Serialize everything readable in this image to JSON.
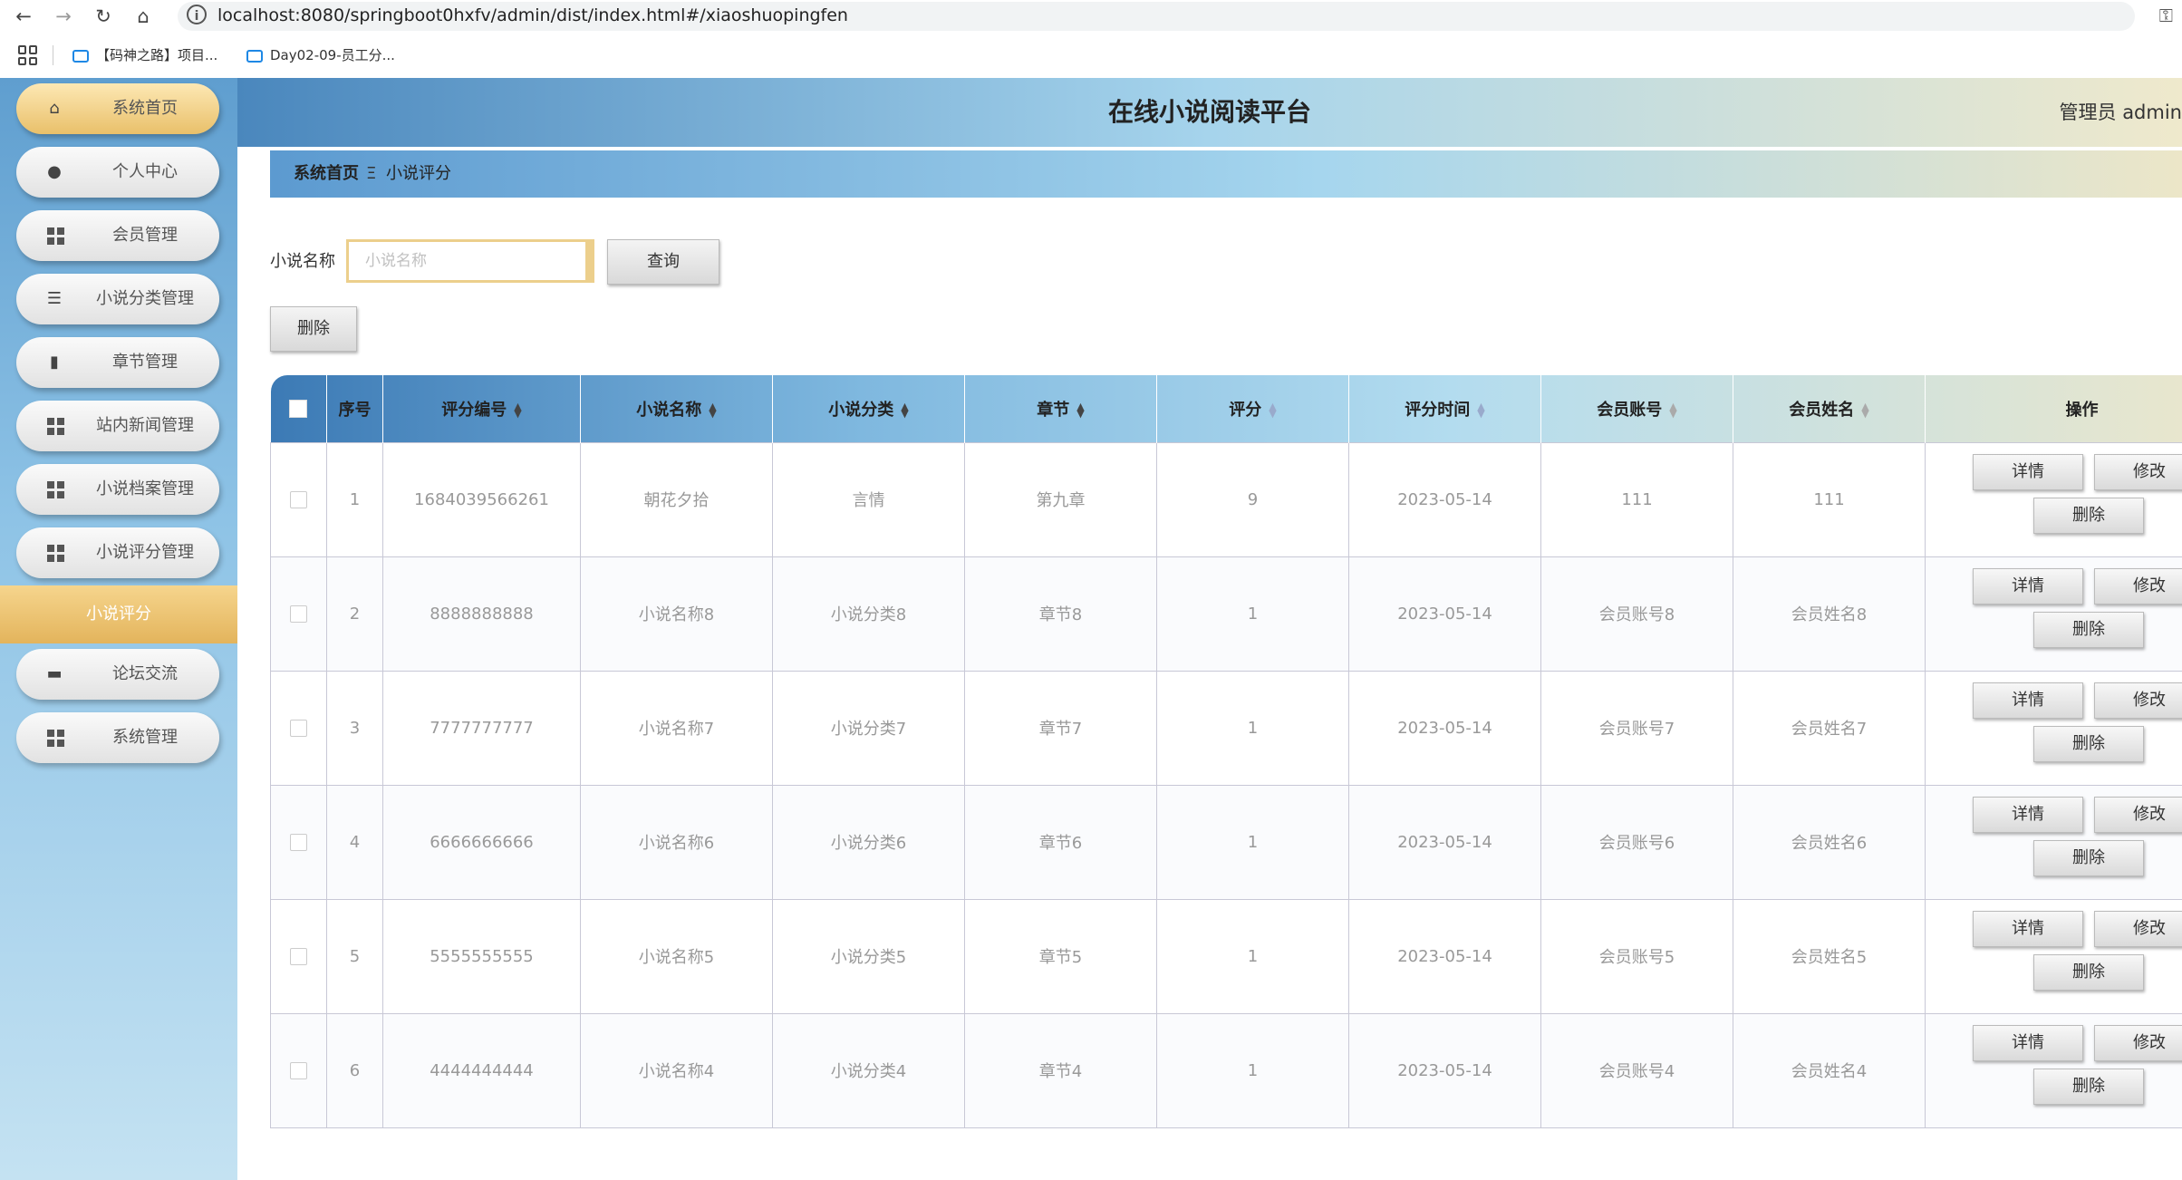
{
  "browser": {
    "url": "localhost:8080/springboot0hxfv/admin/dist/index.html#/xiaoshuopingfen",
    "bookmarks": [
      "【码神之路】项目...",
      "Day02-09-员工分..."
    ]
  },
  "header": {
    "title": "在线小说阅读平台",
    "user": "管理员 admin"
  },
  "sidebar": {
    "items": [
      {
        "label": "系统首页",
        "icon": "home-icon"
      },
      {
        "label": "个人中心",
        "icon": "user-icon"
      },
      {
        "label": "会员管理",
        "icon": "grid-icon"
      },
      {
        "label": "小说分类管理",
        "icon": "sliders-icon"
      },
      {
        "label": "章节管理",
        "icon": "book-icon"
      },
      {
        "label": "站内新闻管理",
        "icon": "grid-icon"
      },
      {
        "label": "小说档案管理",
        "icon": "grid-icon"
      },
      {
        "label": "小说评分管理",
        "icon": "grid-icon"
      }
    ],
    "submenu": "小说评分",
    "items2": [
      {
        "label": "论坛交流",
        "icon": "chat-icon"
      },
      {
        "label": "系统管理",
        "icon": "grid-icon"
      }
    ]
  },
  "breadcrumb": {
    "home": "系统首页",
    "separator": "Ξ",
    "current": "小说评分"
  },
  "search": {
    "label": "小说名称",
    "placeholder": "小说名称",
    "button": "查询"
  },
  "actions": {
    "delete": "删除"
  },
  "table": {
    "columns": [
      "序号",
      "评分编号",
      "小说名称",
      "小说分类",
      "章节",
      "评分",
      "评分时间",
      "会员账号",
      "会员姓名",
      "操作"
    ],
    "rows": [
      [
        "1",
        "1684039566261",
        "朝花夕拾",
        "言情",
        "第九章",
        "9",
        "2023-05-14",
        "111",
        "111"
      ],
      [
        "2",
        "8888888888",
        "小说名称8",
        "小说分类8",
        "章节8",
        "1",
        "2023-05-14",
        "会员账号8",
        "会员姓名8"
      ],
      [
        "3",
        "7777777777",
        "小说名称7",
        "小说分类7",
        "章节7",
        "1",
        "2023-05-14",
        "会员账号7",
        "会员姓名7"
      ],
      [
        "4",
        "6666666666",
        "小说名称6",
        "小说分类6",
        "章节6",
        "1",
        "2023-05-14",
        "会员账号6",
        "会员姓名6"
      ],
      [
        "5",
        "5555555555",
        "小说名称5",
        "小说分类5",
        "章节5",
        "1",
        "2023-05-14",
        "会员账号5",
        "会员姓名5"
      ],
      [
        "6",
        "4444444444",
        "小说名称4",
        "小说分类4",
        "章节4",
        "1",
        "2023-05-14",
        "会员账号4",
        "会员姓名4"
      ]
    ],
    "ops": {
      "detail": "详情",
      "edit": "修改",
      "delete": "删除"
    }
  }
}
